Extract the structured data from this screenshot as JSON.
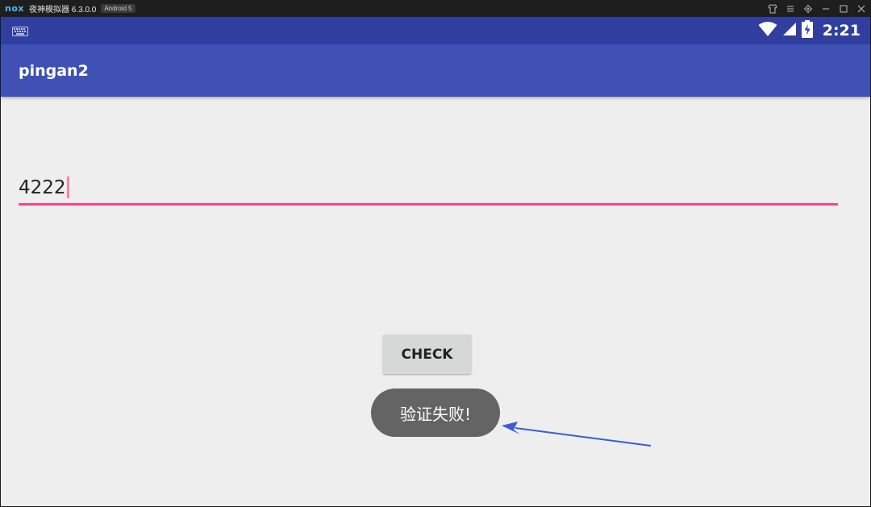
{
  "emulator": {
    "logo": "nox",
    "title": "夜神模拟器 6.3.0.0",
    "badge": "Android 5",
    "controls": [
      "shirt-icon",
      "menu-icon",
      "settings-icon",
      "minimize-icon",
      "maximize-icon",
      "close-icon"
    ]
  },
  "status_bar": {
    "left_icon": "keyboard-icon",
    "icons": [
      "wifi-icon",
      "signal-icon",
      "battery-charging-icon"
    ],
    "time": "2:21"
  },
  "app_bar": {
    "title": "pingan2"
  },
  "edit_field": {
    "value": "4222"
  },
  "check_button": {
    "label": "CHECK"
  },
  "toast": {
    "text": "验证失败!"
  },
  "annotation": {
    "type": "arrow",
    "color": "#3a5bd9"
  },
  "colors": {
    "status_bar": "#303f9f",
    "app_bar": "#3f51b5",
    "accent": "#ff4081",
    "background": "#eeeeee",
    "button": "#d6d7d7",
    "toast": "#646464"
  }
}
